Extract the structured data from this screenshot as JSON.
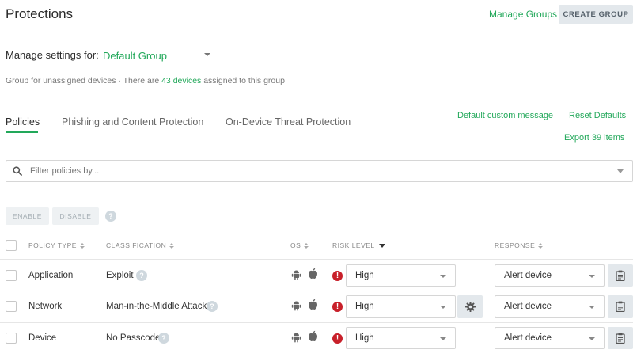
{
  "header": {
    "title": "Protections",
    "manage_groups_label": "Manage Groups",
    "create_group_label": "CREATE GROUP"
  },
  "group_settings": {
    "label": "Manage settings for:",
    "selected_group": "Default Group",
    "desc_prefix": "Group for unassigned devices · There are ",
    "device_link": "43 devices",
    "desc_suffix": " assigned to this group"
  },
  "tabs": [
    {
      "label": "Policies",
      "active": true
    },
    {
      "label": "Phishing and Content Protection",
      "active": false
    },
    {
      "label": "On-Device Threat Protection",
      "active": false
    }
  ],
  "actions": {
    "default_message_label": "Default custom message",
    "reset_defaults_label": "Reset Defaults",
    "export_label": "Export 39 items"
  },
  "filter": {
    "placeholder": "Filter policies by..."
  },
  "bulk": {
    "enable_label": "ENABLE",
    "disable_label": "DISABLE",
    "help": "?"
  },
  "table": {
    "headers": {
      "policy_type": "POLICY TYPE",
      "classification": "CLASSIFICATION",
      "os": "OS",
      "risk_level": "RISK LEVEL",
      "response": "RESPONSE"
    },
    "help_glyph": "?",
    "risk_glyph": "!",
    "rows": [
      {
        "policy_type": "Application",
        "classification": "Exploit",
        "risk_level": "High",
        "response": "Alert device",
        "has_settings": false
      },
      {
        "policy_type": "Network",
        "classification": "Man-in-the-Middle Attack",
        "risk_level": "High",
        "response": "Alert device",
        "has_settings": true
      },
      {
        "policy_type": "Device",
        "classification": "No Passcode",
        "risk_level": "High",
        "response": "Alert device",
        "has_settings": false
      }
    ]
  },
  "colors": {
    "accent_green": "#22a85a",
    "risk_red": "#c8202a",
    "button_gray": "#e3e8ec"
  },
  "icons": {
    "search": "search-icon",
    "android": "android-icon",
    "apple": "apple-icon",
    "gear": "gear-icon",
    "clipboard": "clipboard-icon",
    "risk": "exclamation-icon"
  }
}
